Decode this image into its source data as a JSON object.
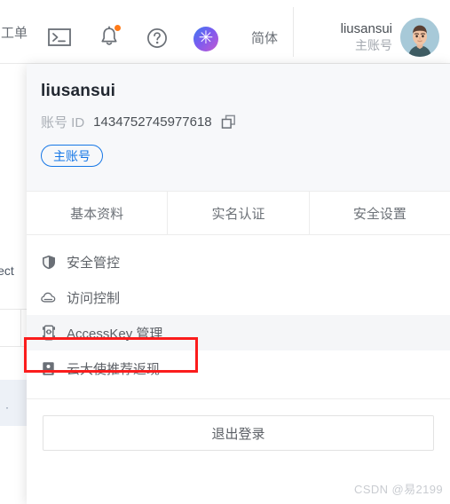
{
  "header": {
    "ticket_label": "工单",
    "icons": [
      {
        "name": "terminal-icon",
        "label": "terminal-icon"
      },
      {
        "name": "bell-icon",
        "label": "bell-icon",
        "has_badge": true
      },
      {
        "name": "help-icon",
        "label": "help-icon"
      },
      {
        "name": "sparkle-ai-icon",
        "label": "sparkle-ai-icon",
        "glyph": "✳"
      }
    ],
    "language": "简体",
    "user": {
      "name": "liusansui",
      "role": "主账号"
    }
  },
  "dropdown": {
    "username": "liusansui",
    "account_id_label": "账号 ID",
    "account_id": "1434752745977618",
    "copy_icon": "copy-icon",
    "badge": "主账号",
    "tabs": [
      {
        "label": "基本资料"
      },
      {
        "label": "实名认证"
      },
      {
        "label": "安全设置"
      }
    ],
    "menu": [
      {
        "label": "安全管控",
        "icon": "shield-icon",
        "active": false
      },
      {
        "label": "访问控制",
        "icon": "cloud-icon",
        "active": false
      },
      {
        "label": "AccessKey 管理",
        "icon": "key-icon",
        "active": true
      },
      {
        "label": "云大使推荐返现",
        "icon": "card-icon",
        "active": false
      }
    ],
    "logout_label": "退出登录"
  },
  "background": {
    "fragment_text": "ject"
  },
  "annotation": {
    "highlight_color": "#fb1c1c",
    "target": "AccessKey 管理"
  },
  "watermark": "CSDN @易2199",
  "colors": {
    "accent_blue": "#1677e6",
    "notification_orange": "#ff7a18",
    "panel_head_bg": "#f7f8fa",
    "active_row_bg": "#f5f6f8"
  }
}
